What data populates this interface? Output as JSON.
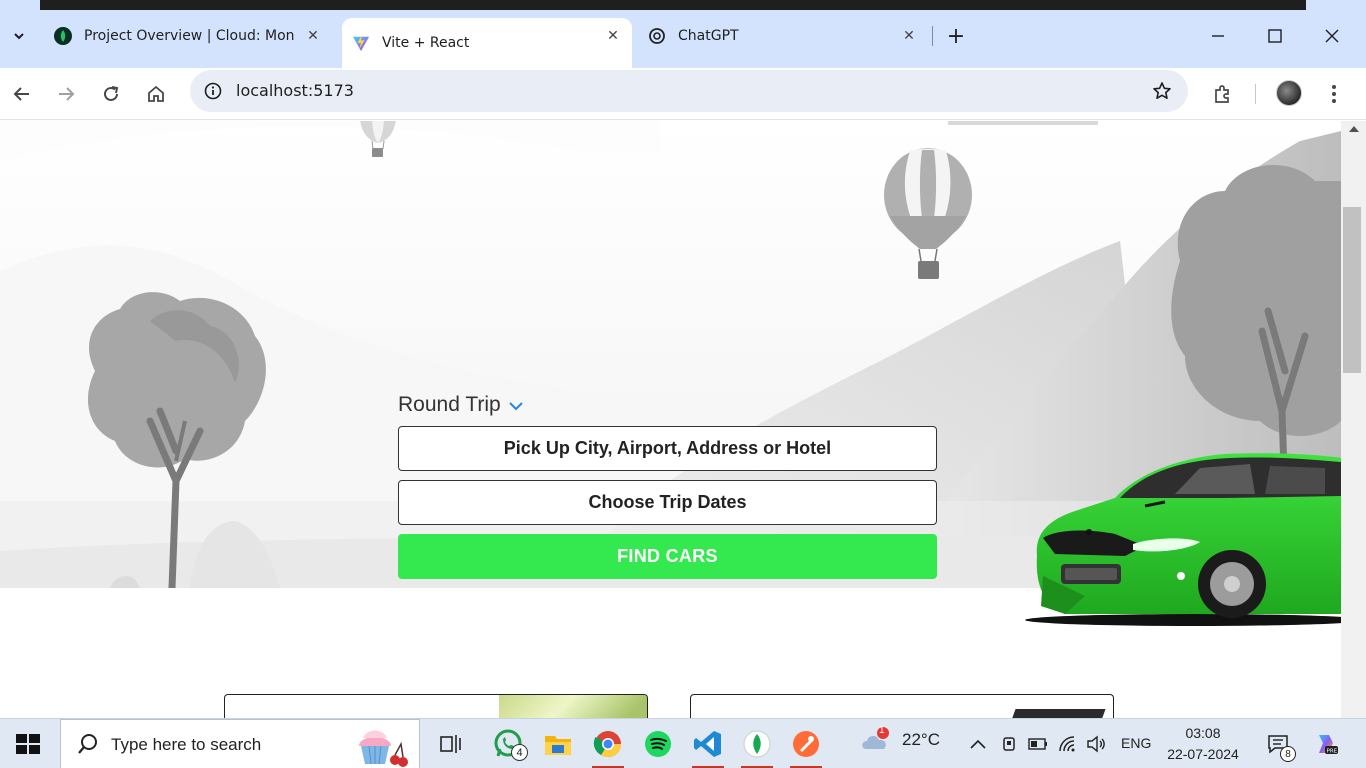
{
  "browser": {
    "tabs": [
      {
        "title": "Project Overview | Cloud: MongoDB",
        "favicon": "mongodb-leaf-icon",
        "active": false
      },
      {
        "title": "Vite + React",
        "favicon": "vite-icon",
        "active": true
      },
      {
        "title": "ChatGPT",
        "favicon": "chatgpt-icon",
        "active": false
      }
    ],
    "url": "localhost:5173"
  },
  "page": {
    "trip_type": "Round Trip",
    "pickup_placeholder": "Pick Up City, Airport, Address or Hotel",
    "dates_placeholder": "Choose Trip Dates",
    "find_button": "FIND CARS",
    "accent_color": "#34e94f",
    "car_color": "#2ecc2e"
  },
  "taskbar": {
    "search_placeholder": "Type here to search",
    "whatsapp_badge": "4",
    "weather_temp": "22°C",
    "weather_alert": "1",
    "language": "ENG",
    "time": "03:08",
    "date": "22-07-2024",
    "notifications": "8"
  }
}
